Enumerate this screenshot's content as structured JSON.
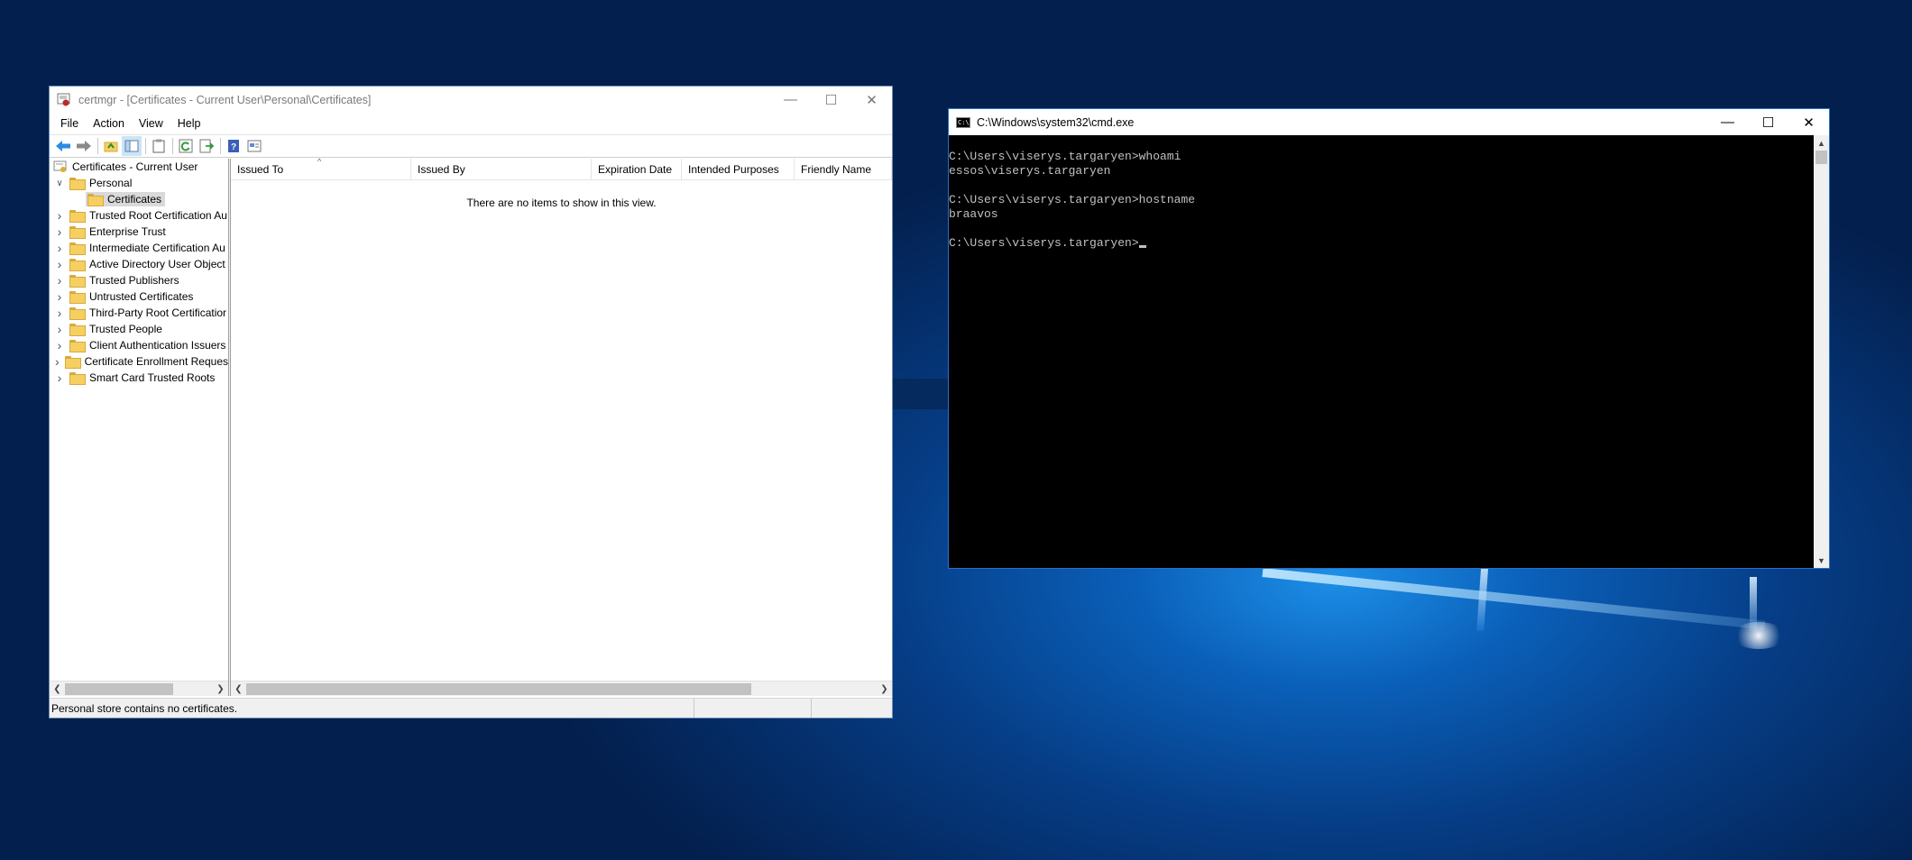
{
  "certmgr": {
    "title": "certmgr - [Certificates - Current User\\Personal\\Certificates]",
    "menu": [
      "File",
      "Action",
      "View",
      "Help"
    ],
    "tree": {
      "root": "Certificates - Current User",
      "personal": "Personal",
      "selected": "Certificates",
      "items": [
        "Trusted Root Certification Au",
        "Enterprise Trust",
        "Intermediate Certification Au",
        "Active Directory User Object",
        "Trusted Publishers",
        "Untrusted Certificates",
        "Third-Party Root Certificatior",
        "Trusted People",
        "Client Authentication Issuers",
        "Certificate Enrollment Reques",
        "Smart Card Trusted Roots"
      ]
    },
    "columns": [
      "Issued To",
      "Issued By",
      "Expiration Date",
      "Intended Purposes",
      "Friendly Name"
    ],
    "empty_message": "There are no items to show in this view.",
    "status": "Personal store contains no certificates."
  },
  "cmd": {
    "title": "C:\\Windows\\system32\\cmd.exe",
    "lines": [
      "C:\\Users\\viserys.targaryen>whoami",
      "essos\\viserys.targaryen",
      "",
      "C:\\Users\\viserys.targaryen>hostname",
      "braavos",
      "",
      "C:\\Users\\viserys.targaryen>"
    ]
  }
}
